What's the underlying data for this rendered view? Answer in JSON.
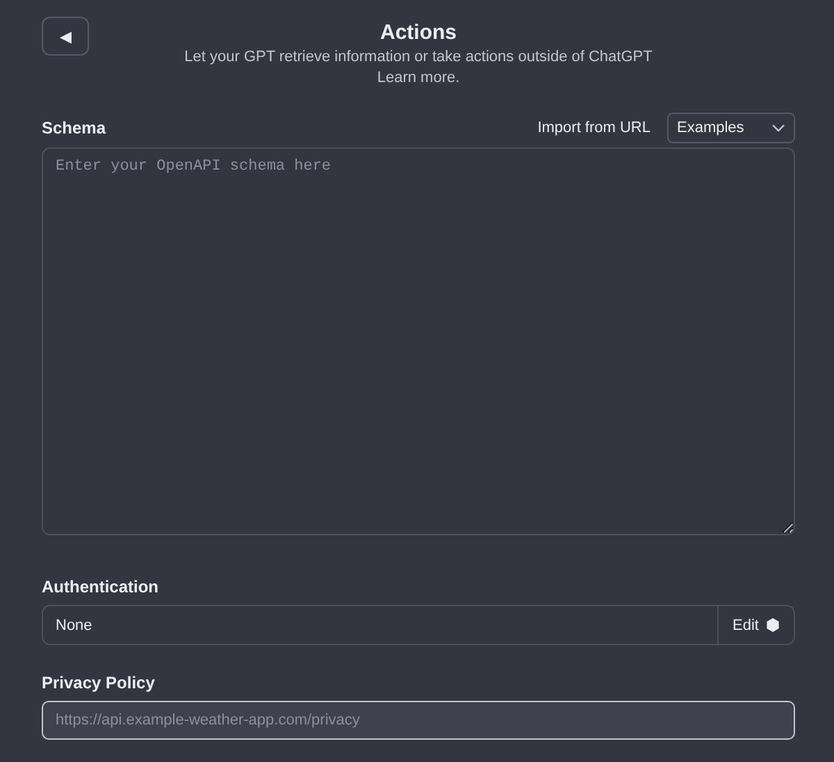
{
  "header": {
    "back_button": "◀",
    "title": "Actions",
    "subtitle": "Let your GPT retrieve information or take actions outside of ChatGPT",
    "learn_more": "Learn more."
  },
  "schema": {
    "label": "Schema",
    "import_link": "Import from URL",
    "examples_dropdown": "Examples",
    "placeholder": "Enter your OpenAPI schema here"
  },
  "authentication": {
    "label": "Authentication",
    "value": "None",
    "edit_button": "Edit"
  },
  "privacy_policy": {
    "label": "Privacy Policy",
    "placeholder": "https://api.example-weather-app.com/privacy",
    "focused": true
  }
}
